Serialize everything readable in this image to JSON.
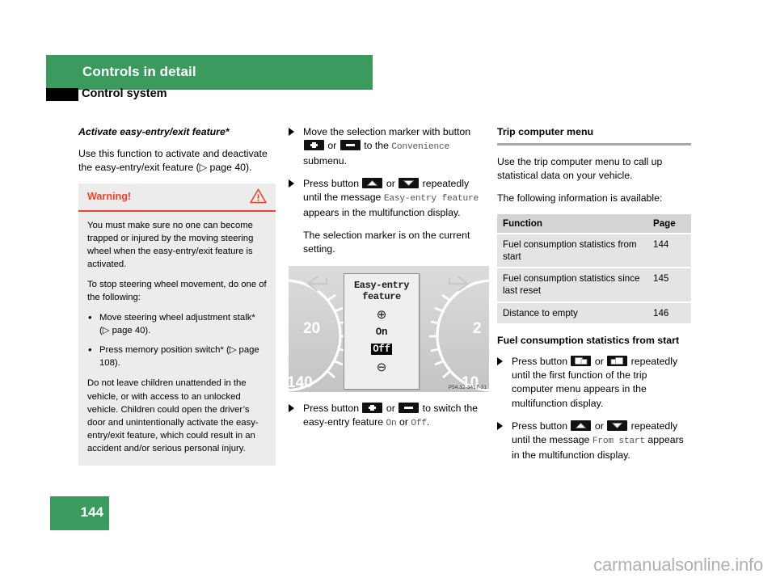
{
  "header": {
    "chapter": "Controls in detail",
    "section": "Control system"
  },
  "left_column": {
    "heading": "Activate easy-entry/exit feature*",
    "intro": "Use this function to activate and deactivate the easy-entry/exit feature (▷ page 40).",
    "warning": {
      "title": "Warning!",
      "icon": "warning-triangle-icon",
      "paragraph1": "You must make sure no one can become trapped or injured by the moving steering wheel when the easy-entry/exit feature is activated.",
      "paragraph2": "To stop steering wheel movement, do one of the following:",
      "bullets": [
        "Move steering wheel adjustment stalk* (▷ page 40).",
        "Press memory position switch* (▷ page 108)."
      ],
      "paragraph3": "Do not leave children unattended in the vehicle, or with access to an unlocked vehicle. Children could open the driver’s door and unintentionally activate the easy-entry/exit feature, which could result in an accident and/or serious personal injury."
    }
  },
  "middle_column": {
    "step1": {
      "pre": "Move the selection marker with button",
      "or": "or",
      "mid": "to the",
      "menu": "Convenience",
      "post": "submenu."
    },
    "step2": {
      "pre": "Press button",
      "or": "or",
      "mid": "repeatedly until the message",
      "message": "Easy-entry feature",
      "post": "appears in the multifunction display."
    },
    "step2_note": "The selection marker is on the current setting.",
    "figure": {
      "caption": "P54.32-3417-31",
      "display_title_line1": "Easy-entry",
      "display_title_line2": "feature",
      "plus_symbol": "⊕",
      "option_on": "On",
      "option_off": "Off",
      "selected_option": "Off",
      "minus_symbol": "⊖",
      "gauge_left_ticks": [
        "20",
        "140"
      ],
      "gauge_right_ticks": [
        "2",
        "10"
      ]
    },
    "step3": {
      "pre": "Press button",
      "or": "or",
      "mid": "to switch the easy-entry feature",
      "value_on": "On",
      "or2": "or",
      "value_off": "Off",
      "post": "."
    }
  },
  "right_column": {
    "heading": "Trip computer menu",
    "intro1": "Use the trip computer menu to call up statistical data on your vehicle.",
    "intro2": "The following information is available:",
    "table": {
      "columns": [
        "Function",
        "Page"
      ],
      "rows": [
        {
          "function": "Fuel consumption statistics from start",
          "page": "144"
        },
        {
          "function": "Fuel consumption statistics since last reset",
          "page": "145"
        },
        {
          "function": "Distance to empty",
          "page": "146"
        }
      ]
    },
    "subheading": "Fuel consumption statistics from start",
    "step1": {
      "pre": "Press button",
      "or": "or",
      "post": "repeatedly until the first function of the trip computer menu appears in the multifunction display."
    },
    "step2": {
      "pre": "Press button",
      "or": "or",
      "mid": "repeatedly until the message",
      "message": "From start",
      "post": "appears in the multifunction display."
    }
  },
  "footer": {
    "page_number": "144",
    "watermark": "carmanualsonline.info"
  },
  "colors": {
    "brand_green": "#3b9b5e",
    "warning_red": "#f0432a",
    "table_header": "#d4d4d4",
    "table_cell": "#e4e4e4",
    "warning_bg": "#ececec"
  },
  "icons": {
    "plus_button": "plus-button-icon",
    "minus_button": "minus-button-icon",
    "up_button": "chevron-up-button-icon",
    "down_button": "chevron-down-button-icon",
    "prev_page_button": "prev-display-button-icon",
    "next_page_button": "next-display-button-icon"
  }
}
